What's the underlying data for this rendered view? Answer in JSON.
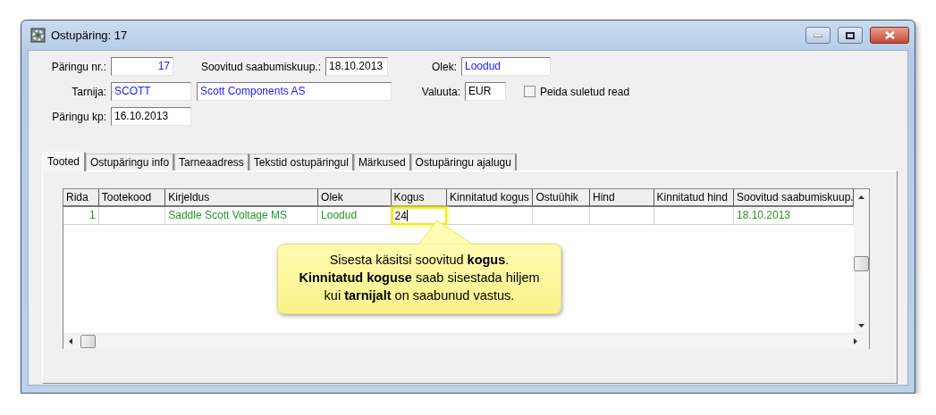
{
  "window": {
    "title": "Ostupäring: 17"
  },
  "form": {
    "rows": [
      {
        "items": [
          {
            "label": "Päringu nr.:",
            "fields": [
              {
                "value": "17",
                "kind": "number"
              }
            ]
          },
          {
            "label": "Soovitud saabumiskuup.:",
            "fields": [
              {
                "value": "18.10.2013",
                "kind": "input"
              }
            ]
          },
          {
            "label": "Olek:",
            "fields": [
              {
                "value": "Loodud",
                "kind": "lookup"
              }
            ]
          }
        ]
      },
      {
        "items": [
          {
            "label": "Tarnija:",
            "fields": [
              {
                "value": "SCOTT",
                "kind": "lookup"
              },
              {
                "value": "Scott Components AS",
                "kind": "lookup"
              }
            ]
          },
          {
            "label": "Valuuta:",
            "fields": [
              {
                "value": "EUR",
                "kind": "input"
              }
            ]
          }
        ]
      },
      {
        "items": [
          {
            "label": "Päringu kp:",
            "fields": [
              {
                "value": "16.10.2013",
                "kind": "input"
              }
            ]
          }
        ]
      }
    ],
    "checkbox": {
      "label": "Peida suletud read",
      "checked": false
    }
  },
  "tabs": [
    {
      "label": "Tooted",
      "selected": true
    },
    {
      "label": "Ostupäringu info",
      "selected": false
    },
    {
      "label": "Tarneaadress",
      "selected": false
    },
    {
      "label": "Tekstid ostupäringul",
      "selected": false
    },
    {
      "label": "Märkused",
      "selected": false
    },
    {
      "label": "Ostupäringu ajalugu",
      "selected": false
    }
  ],
  "table": {
    "columns": [
      "Rida",
      "Tootekood",
      "Kirjeldus",
      "Olek",
      "Kogus",
      "Kinnitatud kogus",
      "Ostuühik",
      "Hind",
      "Kinnitatud hind",
      "Soovitud saabumiskuup."
    ],
    "rows": [
      {
        "cells": [
          {
            "text": "1",
            "editing": false
          },
          {
            "editing": false
          },
          {
            "text": "Saddle Scott Voltage MS",
            "editing": false
          },
          {
            "text": "Loodud",
            "editing": false
          },
          {
            "text": "24",
            "editing": true
          },
          {
            "editing": false
          },
          {
            "editing": false
          },
          {
            "editing": false
          },
          {
            "editing": false
          },
          {
            "text": "18.10.2013",
            "editing": false
          }
        ]
      }
    ]
  },
  "callout": {
    "text": "Sisesta käsitsi soovitud **kogus**.\n**Kinnitatud koguse** saab sisestada hiljem\nkui **tarnijalt** on saabunud vastus."
  }
}
